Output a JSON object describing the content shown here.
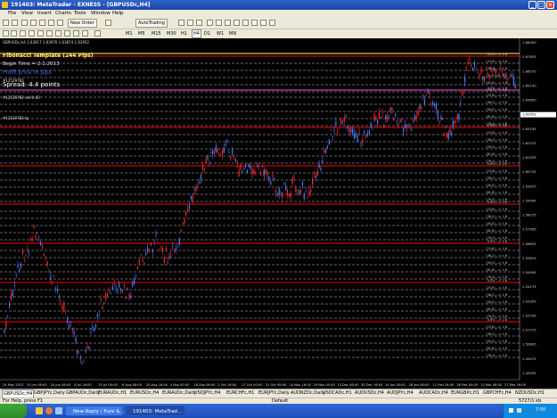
{
  "window": {
    "title": "191403: MetaTrader - EXNESS - [GBPUSDc,H4]"
  },
  "menu": [
    "File",
    "View",
    "Insert",
    "Charts",
    "Tools",
    "Window",
    "Help"
  ],
  "toolbar": {
    "new_order": "New Order",
    "autotrading": "AutoTrading"
  },
  "timeframes": [
    "M1",
    "M5",
    "M15",
    "M30",
    "H1",
    "H4",
    "D1",
    "W1",
    "MN"
  ],
  "chart": {
    "header": "GBPUSDc,H4  1.63917 1.63970 1.63874 1.63952",
    "template_title": "Fibonacci Template (244 Pips)",
    "begin_time": "Begin Time = 2.1.2013",
    "blue_note": "Profit price to pips",
    "spread": "Spread: 4.4 points",
    "order1": "#12529782",
    "order2": "#12529782 sell 0.02",
    "order3": "#12529782 tp",
    "colors": {
      "background": "#000000",
      "bull": "#4a7fff",
      "bear": "#ff2a2a",
      "pink_level": "#ff4fd8",
      "red_level": "#ff0000",
      "fib_dash": "#ffffff",
      "price_label": "#cfcfcf",
      "yellow": "#ffff66"
    },
    "fib_labels": [
      "(23.6) --> 1.6",
      "(38.2) --> 1.6",
      "(50.0) --> 1.6",
      "(61.8) --> 1.6",
      "(76.4) --> 1.6"
    ],
    "price_axis": [
      "1.68450",
      "1.67635",
      "1.66575",
      "1.65150",
      "1.64650",
      "1.63952",
      "1.63195",
      "1.62375",
      "1.61555",
      "1.60735",
      "1.59915",
      "1.59095",
      "1.58275",
      "1.57455",
      "1.56635",
      "1.55815",
      "1.54995",
      "1.54175",
      "1.53355",
      "1.52535",
      "1.51715",
      "1.50895",
      "1.50075",
      "1.49255"
    ],
    "date_axis": [
      "24 May 2013",
      "10 Jun 08:00",
      "24 Jun 08:00",
      "8 Jul 16:00",
      "23 Jul 00:00",
      "6 Aug 08:00",
      "20 Aug 16:00",
      "4 Sep 00:00",
      "18 Sep 08:00",
      "2 Oct 16:00",
      "17 Oct 00:00",
      "31 Oct 08:00",
      "14 Nov 16:00",
      "29 Nov 00:00",
      "13 Dec 08:00",
      "30 Dec 16:00",
      "14 Jan 00:00",
      "28 Jan 08:00",
      "11 Feb 16:00",
      "26 Feb 00:00",
      "12 Mar 08:00",
      "27 Mar 16:00"
    ]
  },
  "tabs": [
    "GBPUSDc,H4",
    "GBPJPYc,Daily",
    "GBPAUDc,Daily",
    "EURAUDc,H1",
    "EURUSDc,H4",
    "EURAUDc,Daily",
    "USDJPYc,H4",
    "EURCHFc,H1",
    "EURJPYc,Daily",
    "AUDNZDc,Daily",
    "USDCADc,H1",
    "AUDUSDc,H4",
    "AUDJPYc,H4",
    "AUDCADc,H4",
    "EURGBPc,H1",
    "GBPCHFc,H4",
    "NZDUSDc,H1"
  ],
  "status": {
    "help": "For Help, press F1",
    "profile": "Default",
    "traffic": "5727/1 kb"
  },
  "taskbar": {
    "items": [
      "New Reply / Pure & ...",
      "191403: MetaTrad..."
    ],
    "time": "7:50"
  }
}
